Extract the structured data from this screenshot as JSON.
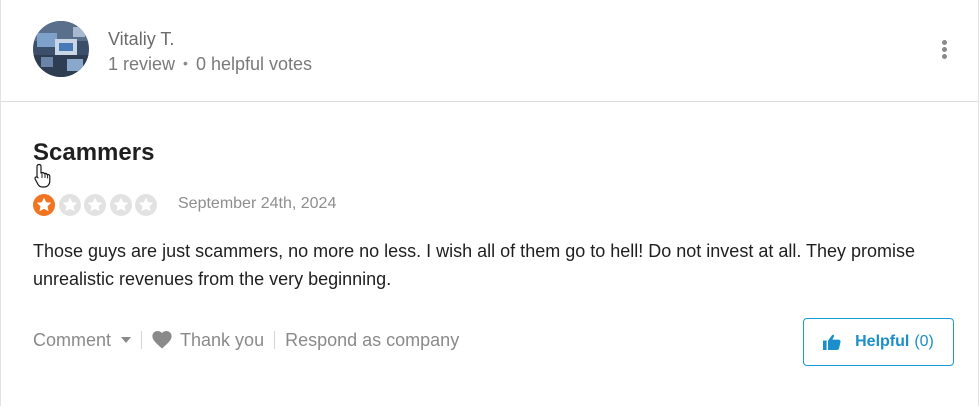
{
  "reviewer": {
    "name": "Vitaliy T.",
    "reviews": "1 review",
    "separator": "•",
    "helpful_votes": "0 helpful votes"
  },
  "review": {
    "title": "Scammers",
    "rating": 1,
    "rating_max": 5,
    "date": "September 24th, 2024",
    "body": "Those guys are just scammers, no more no less. I wish all of them go to hell! Do not invest at all. They promise unrealistic revenues from the very beginning."
  },
  "actions": {
    "comment_label": "Comment",
    "thank_label": "Thank you",
    "respond_label": "Respond as company"
  },
  "helpful": {
    "label": "Helpful",
    "count": "(0)"
  },
  "colors": {
    "star_filled": "#f27421",
    "star_empty": "#e2e2e2",
    "accent": "#1a9ad6"
  },
  "icons": [
    "avatar-image",
    "more-vertical-icon",
    "star-icon",
    "chevron-down-icon",
    "heart-icon",
    "thumbs-up-icon",
    "hand-cursor-icon"
  ]
}
